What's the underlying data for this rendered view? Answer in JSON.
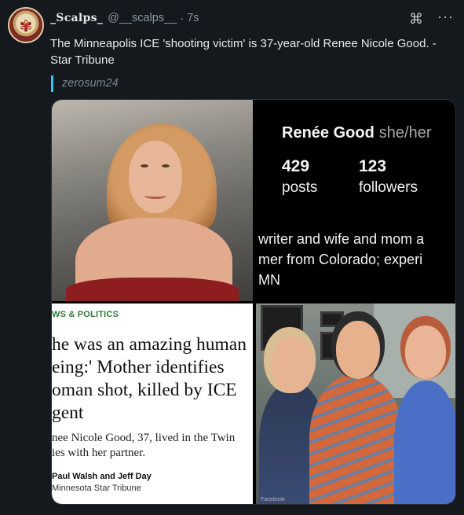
{
  "post": {
    "display_name": "_Scalps_",
    "handle": "@__scalps__",
    "separator": "·",
    "time": "7s",
    "text_line1": "The Minneapolis ICE 'shooting victim' is 37-year-old Renee Nicole Good. -",
    "text_line2": "Star Tribune",
    "quote_author": "zerosum24",
    "icons": {
      "command": "command-icon",
      "more": "more-options-icon"
    }
  },
  "profile_panel": {
    "name": "Renée Good",
    "pronouns": "she/her",
    "posts_count": "429",
    "posts_label": "posts",
    "followers_count": "123",
    "followers_label": "followers",
    "bio_line1": "writer and wife and mom a",
    "bio_line2": "mer from Colorado; experi",
    "bio_line3": "MN"
  },
  "article": {
    "section": "WS & POLITICS",
    "headline_line1": "he was an amazing human",
    "headline_line2": "eing:' Mother identifies",
    "headline_line3": "oman shot, killed by ICE",
    "headline_line4": "gent",
    "dek_line1": "nee Nicole Good, 37, lived in the Twin",
    "dek_line2": "ies with her partner.",
    "byline": "Paul Walsh and Jeff Day",
    "source": "Minnesota Star Tribune"
  },
  "photo2": {
    "watermark": "Facebook"
  },
  "colors": {
    "background": "#15181d",
    "quote_bar": "#40c4e6",
    "section_green": "#2f7a3b",
    "dress_red": "#8e1d1f"
  }
}
